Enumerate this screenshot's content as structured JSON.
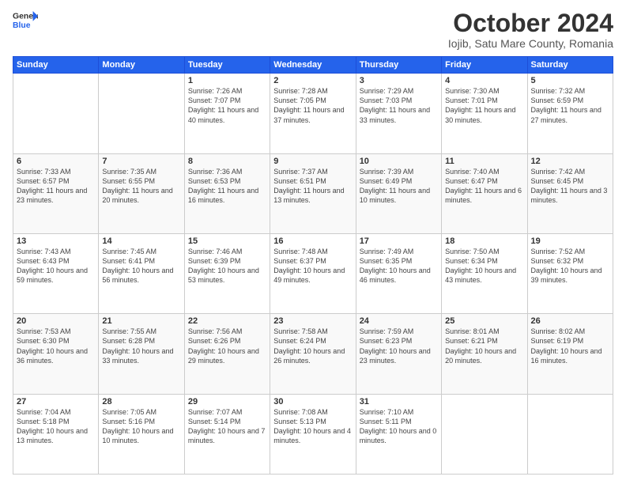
{
  "header": {
    "logo_general": "General",
    "logo_blue": "Blue",
    "title": "October 2024",
    "subtitle": "Iojib, Satu Mare County, Romania"
  },
  "weekdays": [
    "Sunday",
    "Monday",
    "Tuesday",
    "Wednesday",
    "Thursday",
    "Friday",
    "Saturday"
  ],
  "weeks": [
    [
      {
        "day": "",
        "info": ""
      },
      {
        "day": "",
        "info": ""
      },
      {
        "day": "1",
        "info": "Sunrise: 7:26 AM\nSunset: 7:07 PM\nDaylight: 11 hours and 40 minutes."
      },
      {
        "day": "2",
        "info": "Sunrise: 7:28 AM\nSunset: 7:05 PM\nDaylight: 11 hours and 37 minutes."
      },
      {
        "day": "3",
        "info": "Sunrise: 7:29 AM\nSunset: 7:03 PM\nDaylight: 11 hours and 33 minutes."
      },
      {
        "day": "4",
        "info": "Sunrise: 7:30 AM\nSunset: 7:01 PM\nDaylight: 11 hours and 30 minutes."
      },
      {
        "day": "5",
        "info": "Sunrise: 7:32 AM\nSunset: 6:59 PM\nDaylight: 11 hours and 27 minutes."
      }
    ],
    [
      {
        "day": "6",
        "info": "Sunrise: 7:33 AM\nSunset: 6:57 PM\nDaylight: 11 hours and 23 minutes."
      },
      {
        "day": "7",
        "info": "Sunrise: 7:35 AM\nSunset: 6:55 PM\nDaylight: 11 hours and 20 minutes."
      },
      {
        "day": "8",
        "info": "Sunrise: 7:36 AM\nSunset: 6:53 PM\nDaylight: 11 hours and 16 minutes."
      },
      {
        "day": "9",
        "info": "Sunrise: 7:37 AM\nSunset: 6:51 PM\nDaylight: 11 hours and 13 minutes."
      },
      {
        "day": "10",
        "info": "Sunrise: 7:39 AM\nSunset: 6:49 PM\nDaylight: 11 hours and 10 minutes."
      },
      {
        "day": "11",
        "info": "Sunrise: 7:40 AM\nSunset: 6:47 PM\nDaylight: 11 hours and 6 minutes."
      },
      {
        "day": "12",
        "info": "Sunrise: 7:42 AM\nSunset: 6:45 PM\nDaylight: 11 hours and 3 minutes."
      }
    ],
    [
      {
        "day": "13",
        "info": "Sunrise: 7:43 AM\nSunset: 6:43 PM\nDaylight: 10 hours and 59 minutes."
      },
      {
        "day": "14",
        "info": "Sunrise: 7:45 AM\nSunset: 6:41 PM\nDaylight: 10 hours and 56 minutes."
      },
      {
        "day": "15",
        "info": "Sunrise: 7:46 AM\nSunset: 6:39 PM\nDaylight: 10 hours and 53 minutes."
      },
      {
        "day": "16",
        "info": "Sunrise: 7:48 AM\nSunset: 6:37 PM\nDaylight: 10 hours and 49 minutes."
      },
      {
        "day": "17",
        "info": "Sunrise: 7:49 AM\nSunset: 6:35 PM\nDaylight: 10 hours and 46 minutes."
      },
      {
        "day": "18",
        "info": "Sunrise: 7:50 AM\nSunset: 6:34 PM\nDaylight: 10 hours and 43 minutes."
      },
      {
        "day": "19",
        "info": "Sunrise: 7:52 AM\nSunset: 6:32 PM\nDaylight: 10 hours and 39 minutes."
      }
    ],
    [
      {
        "day": "20",
        "info": "Sunrise: 7:53 AM\nSunset: 6:30 PM\nDaylight: 10 hours and 36 minutes."
      },
      {
        "day": "21",
        "info": "Sunrise: 7:55 AM\nSunset: 6:28 PM\nDaylight: 10 hours and 33 minutes."
      },
      {
        "day": "22",
        "info": "Sunrise: 7:56 AM\nSunset: 6:26 PM\nDaylight: 10 hours and 29 minutes."
      },
      {
        "day": "23",
        "info": "Sunrise: 7:58 AM\nSunset: 6:24 PM\nDaylight: 10 hours and 26 minutes."
      },
      {
        "day": "24",
        "info": "Sunrise: 7:59 AM\nSunset: 6:23 PM\nDaylight: 10 hours and 23 minutes."
      },
      {
        "day": "25",
        "info": "Sunrise: 8:01 AM\nSunset: 6:21 PM\nDaylight: 10 hours and 20 minutes."
      },
      {
        "day": "26",
        "info": "Sunrise: 8:02 AM\nSunset: 6:19 PM\nDaylight: 10 hours and 16 minutes."
      }
    ],
    [
      {
        "day": "27",
        "info": "Sunrise: 7:04 AM\nSunset: 5:18 PM\nDaylight: 10 hours and 13 minutes."
      },
      {
        "day": "28",
        "info": "Sunrise: 7:05 AM\nSunset: 5:16 PM\nDaylight: 10 hours and 10 minutes."
      },
      {
        "day": "29",
        "info": "Sunrise: 7:07 AM\nSunset: 5:14 PM\nDaylight: 10 hours and 7 minutes."
      },
      {
        "day": "30",
        "info": "Sunrise: 7:08 AM\nSunset: 5:13 PM\nDaylight: 10 hours and 4 minutes."
      },
      {
        "day": "31",
        "info": "Sunrise: 7:10 AM\nSunset: 5:11 PM\nDaylight: 10 hours and 0 minutes."
      },
      {
        "day": "",
        "info": ""
      },
      {
        "day": "",
        "info": ""
      }
    ]
  ]
}
